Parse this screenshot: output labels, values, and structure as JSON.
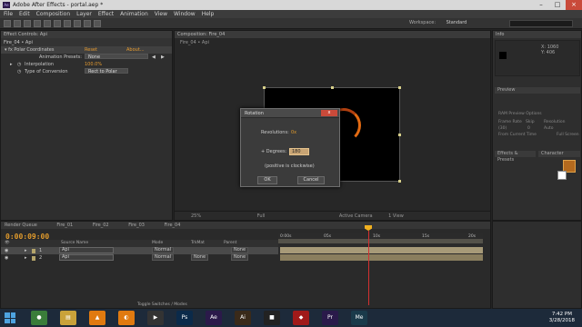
{
  "app": {
    "title": "Adobe After Effects - portal.aep *",
    "icon": "Ae"
  },
  "menu": [
    "File",
    "Edit",
    "Composition",
    "Layer",
    "Effect",
    "Animation",
    "View",
    "Window",
    "Help"
  ],
  "toolbar": {
    "workspace_label": "Workspace:",
    "workspace_value": "Standard"
  },
  "effect_controls": {
    "tab_label": "Effect Controls: Api",
    "breadcrumb": "Fire_04 • Api",
    "effect_name": "Polar Coordinates",
    "reset_label": "Reset",
    "about_label": "About...",
    "presets_label": "Animation Presets:",
    "presets_value": "None",
    "interpolation_label": "Interpolation",
    "interpolation_value": "100.0%",
    "conversion_label": "Type of Conversion",
    "conversion_value": "Rect to Polar"
  },
  "composition": {
    "tab_label": "Composition: Fire_04",
    "breadcrumb": "Fire_04  •  Api",
    "zoom": "25%",
    "quality": "Full",
    "camera": "Active Camera",
    "views": "1 View"
  },
  "right_panels": {
    "info_tab": "Info",
    "info_x": "X: 1060",
    "info_y": "Y: 406",
    "preview_tab": "Preview",
    "ram_label": "RAM Preview Options",
    "framerate_label": "Frame Rate",
    "skip_label": "Skip",
    "resolution_label": "Resolution",
    "framerate_value": "(30)",
    "skip_value": "0",
    "resolution_value": "Auto",
    "from_label": "From Current Time",
    "fullscreen_label": "Full Screen",
    "effects_tab": "Effects & Presets",
    "character_tab": "Character"
  },
  "timeline": {
    "tabs": [
      "Render Queue",
      "Fire_01",
      "Fire_02",
      "Fire_03",
      "Fire_04"
    ],
    "timecode": "0:00:09:00",
    "columns": {
      "source": "Source Name",
      "mode": "Mode",
      "trkmat": "TrkMat",
      "parent": "Parent"
    },
    "layers": [
      {
        "num": "1",
        "name": "Api",
        "mode": "Normal",
        "trkmat": "",
        "parent": "None"
      },
      {
        "num": "2",
        "name": "Api",
        "mode": "Normal",
        "trkmat": "None",
        "parent": "None"
      }
    ],
    "ruler": [
      "0:00s",
      "05s",
      "10s",
      "15s",
      "20s"
    ],
    "toggle_label": "Toggle Switches / Modes"
  },
  "dialog": {
    "title": "Rotation",
    "close_label": "x",
    "revolutions_label": "Revolutions:",
    "revolutions_value": "0x",
    "degrees_label": "+ Degrees:",
    "degrees_value": "180",
    "hint": "(positive is clockwise)",
    "ok_label": "OK",
    "cancel_label": "Cancel"
  },
  "taskbar": {
    "time": "7:42 PM",
    "date": "3/28/2018",
    "apps": [
      {
        "icon": "chrome-icon",
        "color": "#3a7d3a",
        "glyph": "●"
      },
      {
        "icon": "explorer-icon",
        "color": "#c9a23a",
        "glyph": "▤"
      },
      {
        "icon": "vlc-icon",
        "color": "#e07a10",
        "glyph": "▲"
      },
      {
        "icon": "blender-icon",
        "color": "#e07a10",
        "glyph": "◐"
      },
      {
        "icon": "media-icon",
        "color": "#333",
        "glyph": "▶"
      },
      {
        "icon": "ps-icon",
        "color": "#0b2a4a",
        "glyph": "Ps"
      },
      {
        "icon": "ae-icon",
        "color": "#2b1a4a",
        "glyph": "Ae"
      },
      {
        "icon": "ai-icon",
        "color": "#3a2a1a",
        "glyph": "Ai"
      },
      {
        "icon": "terminal-icon",
        "color": "#222",
        "glyph": "■"
      },
      {
        "icon": "app-icon",
        "color": "#a01a1a",
        "glyph": "◆"
      },
      {
        "icon": "pr-icon",
        "color": "#2a1a4a",
        "glyph": "Pr"
      },
      {
        "icon": "me-icon",
        "color": "#1a3a4a",
        "glyph": "Me"
      }
    ]
  }
}
